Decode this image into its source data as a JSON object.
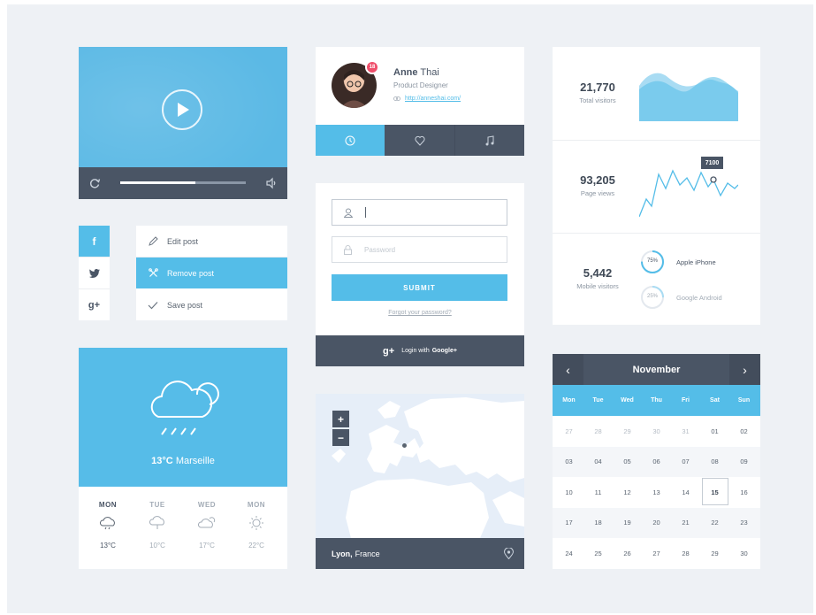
{
  "colors": {
    "accent": "#54bde8",
    "dark": "#4a5565",
    "bg": "#eef1f5",
    "badge": "#ef4f6b"
  },
  "video_player": {
    "play_icon": "play-icon",
    "progress": 0.6,
    "icons": [
      "refresh-icon",
      "volume-icon"
    ]
  },
  "social": {
    "facebook": "f",
    "twitter_icon": "twitter-bird-icon",
    "googleplus": "g+"
  },
  "post_menu": {
    "items": [
      {
        "label": "Edit post",
        "icon": "pencil-icon"
      },
      {
        "label": "Remove post",
        "icon": "close-icon"
      },
      {
        "label": "Save post",
        "icon": "checkmark-icon"
      }
    ]
  },
  "weather": {
    "current_temp": "13°C",
    "city": "Marseille",
    "icon": "rain-cloud-icon",
    "forecast": [
      {
        "day": "MON",
        "temp": "13°C",
        "icon": "rain-cloud-icon"
      },
      {
        "day": "TUE",
        "temp": "10°C",
        "icon": "cloud-icon"
      },
      {
        "day": "WED",
        "temp": "17°C",
        "icon": "partly-cloudy-icon"
      },
      {
        "day": "MON",
        "temp": "22°C",
        "icon": "sun-icon"
      }
    ]
  },
  "profile": {
    "badge": "18",
    "first_name": "Anne",
    "last_name": "Thai",
    "role": "Product Designer",
    "link": "http://anneshai.com/",
    "tabs": [
      "clock-icon",
      "heart-icon",
      "music-icon"
    ]
  },
  "login": {
    "username_placeholder": "",
    "password_placeholder": "Password",
    "submit": "SUBMIT",
    "forgot": "Forgot your password?",
    "google_prefix": "Login with",
    "google_bold": "Google+",
    "google_icon": "g+"
  },
  "map": {
    "zoom_in": "+",
    "zoom_out": "−",
    "city": "Lyon,",
    "country": "France",
    "pin_icon": "location-pin-icon"
  },
  "stats": {
    "total_visitors": {
      "value": "21,770",
      "label": "Total visitors"
    },
    "page_views": {
      "value": "93,205",
      "label": "Page views",
      "tooltip": "7100"
    },
    "mobile_visitors": {
      "value": "5,442",
      "label": "Mobile visitors"
    },
    "devices": [
      {
        "pct": "75%",
        "name": "Apple iPhone",
        "fraction": 0.75
      },
      {
        "pct": "25%",
        "name": "Google Android",
        "fraction": 0.25
      }
    ]
  },
  "calendar": {
    "month": "November",
    "days_of_week": [
      "Mon",
      "Tue",
      "Wed",
      "Thu",
      "Fri",
      "Sat",
      "Sun"
    ],
    "weeks": [
      [
        "27",
        "28",
        "29",
        "30",
        "31",
        "01",
        "02"
      ],
      [
        "03",
        "04",
        "05",
        "06",
        "07",
        "08",
        "09"
      ],
      [
        "10",
        "11",
        "12",
        "13",
        "14",
        "15",
        "16"
      ],
      [
        "17",
        "18",
        "19",
        "20",
        "21",
        "22",
        "23"
      ],
      [
        "24",
        "25",
        "26",
        "27",
        "28",
        "29",
        "30"
      ]
    ],
    "selected": "15"
  }
}
